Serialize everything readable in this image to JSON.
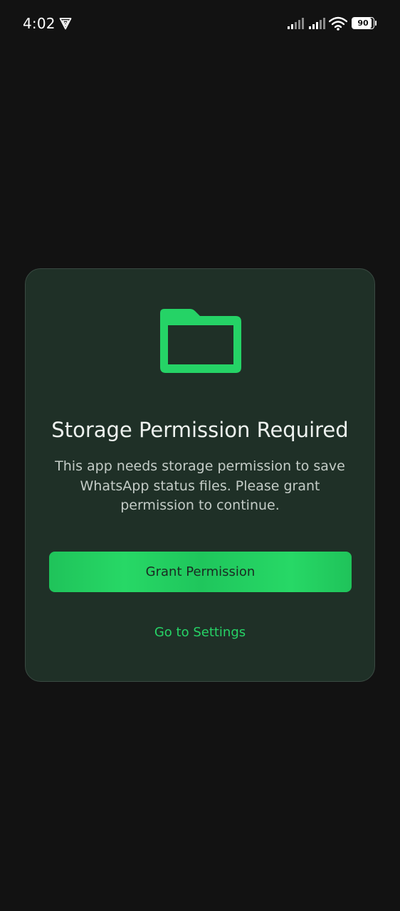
{
  "status_bar": {
    "time": "4:02",
    "battery_percent": "90",
    "battery_level": 0.9
  },
  "icons": {
    "vpn": "vpn-shield-icon",
    "signal_1": "cellular-signal-icon",
    "signal_2": "cellular-signal-icon",
    "wifi": "wifi-icon",
    "battery": "battery-icon",
    "folder": "folder-icon"
  },
  "colors": {
    "background": "#121212",
    "card_background": "#1f3027",
    "accent_green": "#25d366",
    "title_text": "#eef2ef",
    "body_text": "#c4ccc7"
  },
  "dialog": {
    "title": "Storage Permission Required",
    "message": "This app needs storage permission to save WhatsApp status files. Please grant permission to continue.",
    "primary_button_label": "Grant Permission",
    "secondary_link_label": "Go to Settings"
  }
}
